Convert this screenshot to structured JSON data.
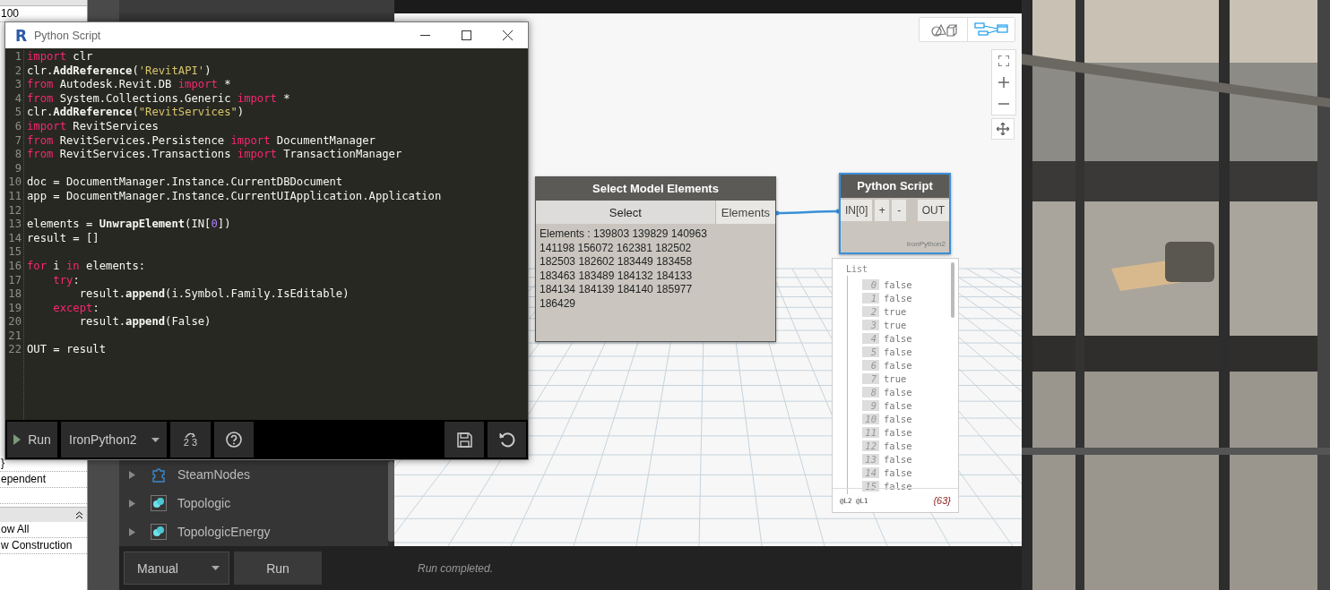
{
  "revit_properties": {
    "top_rows": [
      "100"
    ],
    "bottom_rows": [
      "}",
      "ependent",
      ""
    ],
    "section_rows": [
      "ow All",
      "w Construction"
    ]
  },
  "library": {
    "items": [
      {
        "label": "SteamNodes",
        "kind": "puzzle"
      },
      {
        "label": "Topologic",
        "kind": "spheres"
      },
      {
        "label": "TopologicEnergy",
        "kind": "spheres"
      }
    ]
  },
  "canvas": {
    "view_modes": [
      {
        "kind": "geometry",
        "selected": false
      },
      {
        "kind": "graph",
        "selected": true
      }
    ],
    "select_node": {
      "title": "Select Model Elements",
      "button": "Select",
      "output": "Elements",
      "value": "Elements : 139803 139829 140963 141198 156072 162381 182502 182503 182602 183449 183458 183463 183489 184132 184133 184134 184139 184140 185977 186429"
    },
    "python_node": {
      "title": "Python Script",
      "input": "IN[0]",
      "add": "+",
      "remove": "-",
      "output": "OUT",
      "engine": "IronPython2",
      "selected": true
    },
    "watch": {
      "header": "List",
      "items": [
        {
          "index": "0",
          "value": "false"
        },
        {
          "index": "1",
          "value": "false"
        },
        {
          "index": "2",
          "value": "true"
        },
        {
          "index": "3",
          "value": "true"
        },
        {
          "index": "4",
          "value": "false"
        },
        {
          "index": "5",
          "value": "false"
        },
        {
          "index": "6",
          "value": "false"
        },
        {
          "index": "7",
          "value": "true"
        },
        {
          "index": "8",
          "value": "false"
        },
        {
          "index": "9",
          "value": "false"
        },
        {
          "index": "10",
          "value": "false"
        },
        {
          "index": "11",
          "value": "false"
        },
        {
          "index": "12",
          "value": "false"
        },
        {
          "index": "13",
          "value": "false"
        },
        {
          "index": "14",
          "value": "false"
        },
        {
          "index": "15",
          "value": "false"
        }
      ],
      "levels": "@L2 @L1",
      "count": "{63}"
    }
  },
  "run_bar": {
    "mode": "Manual",
    "run": "Run",
    "status": "Run completed."
  },
  "python_window": {
    "badge": "R",
    "title": "Python Script",
    "code_lines": [
      {
        "number": "1",
        "tokens": [
          {
            "kind": "keyword",
            "t": "import"
          },
          {
            "kind": "plain",
            "t": " clr"
          }
        ]
      },
      {
        "number": "2",
        "tokens": [
          {
            "kind": "plain",
            "t": "clr."
          },
          {
            "kind": "call",
            "t": "AddReference"
          },
          {
            "kind": "plain",
            "t": "("
          },
          {
            "kind": "string",
            "t": "'RevitAPI'"
          },
          {
            "kind": "plain",
            "t": ")"
          }
        ]
      },
      {
        "number": "3",
        "tokens": [
          {
            "kind": "keyword",
            "t": "from"
          },
          {
            "kind": "plain",
            "t": " Autodesk.Revit.DB "
          },
          {
            "kind": "keyword",
            "t": "import"
          },
          {
            "kind": "plain",
            "t": " *"
          }
        ]
      },
      {
        "number": "4",
        "tokens": [
          {
            "kind": "keyword",
            "t": "from"
          },
          {
            "kind": "plain",
            "t": " System.Collections.Generic "
          },
          {
            "kind": "keyword",
            "t": "import"
          },
          {
            "kind": "plain",
            "t": " *"
          }
        ]
      },
      {
        "number": "5",
        "tokens": [
          {
            "kind": "plain",
            "t": "clr."
          },
          {
            "kind": "call",
            "t": "AddReference"
          },
          {
            "kind": "plain",
            "t": "("
          },
          {
            "kind": "string",
            "t": "\"RevitServices\""
          },
          {
            "kind": "plain",
            "t": ")"
          }
        ]
      },
      {
        "number": "6",
        "tokens": [
          {
            "kind": "keyword",
            "t": "import"
          },
          {
            "kind": "plain",
            "t": " RevitServices"
          }
        ]
      },
      {
        "number": "7",
        "tokens": [
          {
            "kind": "keyword",
            "t": "from"
          },
          {
            "kind": "plain",
            "t": " RevitServices.Persistence "
          },
          {
            "kind": "keyword",
            "t": "import"
          },
          {
            "kind": "plain",
            "t": " DocumentManager"
          }
        ]
      },
      {
        "number": "8",
        "tokens": [
          {
            "kind": "keyword",
            "t": "from"
          },
          {
            "kind": "plain",
            "t": " RevitServices.Transactions "
          },
          {
            "kind": "keyword",
            "t": "import"
          },
          {
            "kind": "plain",
            "t": " TransactionManager"
          }
        ]
      },
      {
        "number": "9"
      },
      {
        "number": "10",
        "tokens": [
          {
            "kind": "plain",
            "t": "doc = DocumentManager.Instance.CurrentDBDocument"
          }
        ]
      },
      {
        "number": "11",
        "tokens": [
          {
            "kind": "plain",
            "t": "app = DocumentManager.Instance.CurrentUIApplication.Application"
          }
        ]
      },
      {
        "number": "12"
      },
      {
        "number": "13",
        "tokens": [
          {
            "kind": "plain",
            "t": "elements = "
          },
          {
            "kind": "call",
            "t": "UnwrapElement"
          },
          {
            "kind": "plain",
            "t": "(IN["
          },
          {
            "kind": "number",
            "t": "0"
          },
          {
            "kind": "plain",
            "t": "])"
          }
        ]
      },
      {
        "number": "14",
        "tokens": [
          {
            "kind": "plain",
            "t": "result = []"
          }
        ]
      },
      {
        "number": "15"
      },
      {
        "number": "16",
        "tokens": [
          {
            "kind": "keyword",
            "t": "for"
          },
          {
            "kind": "plain",
            "t": " i "
          },
          {
            "kind": "keyword",
            "t": "in"
          },
          {
            "kind": "plain",
            "t": " elements:"
          }
        ]
      },
      {
        "number": "17",
        "tokens": [
          {
            "kind": "keyword",
            "t": "    try"
          },
          {
            "kind": "plain",
            "t": ":"
          }
        ]
      },
      {
        "number": "18",
        "tokens": [
          {
            "kind": "plain",
            "t": "        result."
          },
          {
            "kind": "call",
            "t": "append"
          },
          {
            "kind": "plain",
            "t": "(i.Symbol.Family.IsEditable)"
          }
        ]
      },
      {
        "number": "19",
        "tokens": [
          {
            "kind": "keyword",
            "t": "    except"
          },
          {
            "kind": "plain",
            "t": ":"
          }
        ]
      },
      {
        "number": "20",
        "tokens": [
          {
            "kind": "plain",
            "t": "        result."
          },
          {
            "kind": "call",
            "t": "append"
          },
          {
            "kind": "plain",
            "t": "(False)"
          }
        ]
      },
      {
        "number": "21"
      },
      {
        "number": "22",
        "tokens": [
          {
            "kind": "plain",
            "t": "OUT = result"
          }
        ]
      }
    ],
    "run": "Run",
    "engine": "IronPython2",
    "migrate_digits": "2 3"
  }
}
